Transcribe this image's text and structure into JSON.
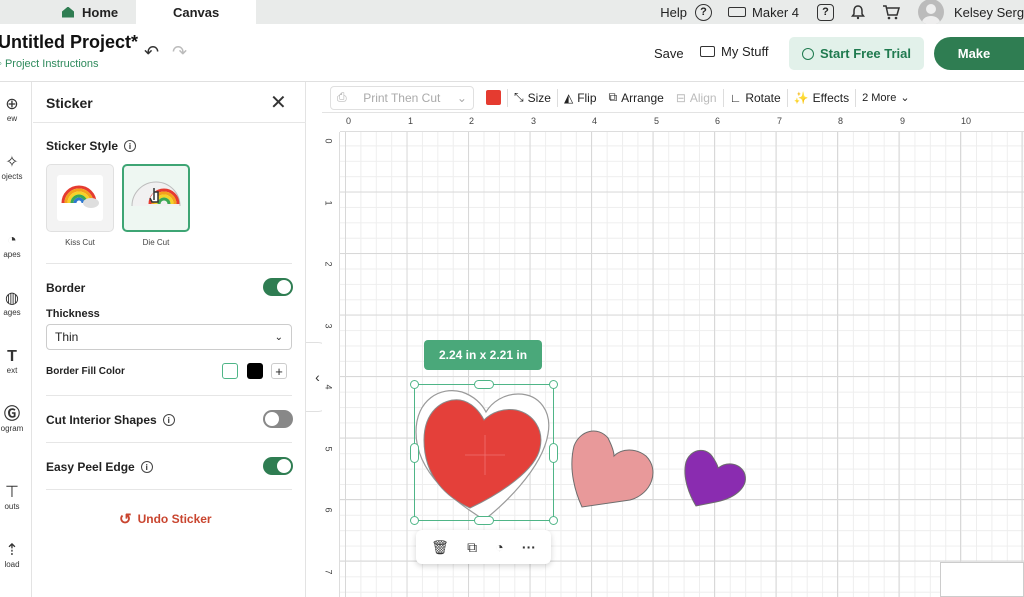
{
  "topbar": {
    "home": "Home",
    "canvas": "Canvas",
    "help": "Help",
    "machine": "Maker 4",
    "user": "Kelsey Sergi"
  },
  "header": {
    "title": "Untitled Project*",
    "instructions": "Project Instructions",
    "save": "Save",
    "my_stuff": "My Stuff",
    "trial": "Start Free Trial",
    "make": "Make"
  },
  "rail": [
    "ew",
    "ojects",
    "apes",
    "ages",
    "ext",
    "ogram",
    "outs",
    "load"
  ],
  "panel": {
    "title": "Sticker",
    "sticker_style": "Sticker Style",
    "styles": [
      "Kiss Cut",
      "Die Cut"
    ],
    "border": "Border",
    "thickness": "Thickness",
    "thickness_value": "Thin",
    "border_fill": "Border Fill Color",
    "cut_interior": "Cut Interior Shapes",
    "easy_peel": "Easy Peel Edge",
    "undo_sticker": "Undo Sticker",
    "toggles": {
      "border": true,
      "cut_interior": false,
      "easy_peel": true
    }
  },
  "toolbar": {
    "print_then_cut": "Print Then Cut",
    "size": "Size",
    "flip": "Flip",
    "arrange": "Arrange",
    "align": "Align",
    "rotate": "Rotate",
    "effects": "Effects",
    "more": "2 More",
    "color": "#e53b30"
  },
  "canvas": {
    "ruler_top": [
      "0",
      "1",
      "2",
      "3",
      "4",
      "5",
      "6",
      "7",
      "8",
      "9",
      "10"
    ],
    "ruler_left": [
      "0",
      "1",
      "2",
      "3",
      "4",
      "5",
      "6",
      "7"
    ],
    "size_badge": "2.24  in x 2.21  in",
    "shapes": [
      {
        "name": "red-heart",
        "color": "#e4403a"
      },
      {
        "name": "pink-heart",
        "color": "#e8999a"
      },
      {
        "name": "purple-heart",
        "color": "#8a2cb0"
      }
    ]
  },
  "colors": {
    "accent": "#2f7d52",
    "undo": "#c9452f"
  }
}
